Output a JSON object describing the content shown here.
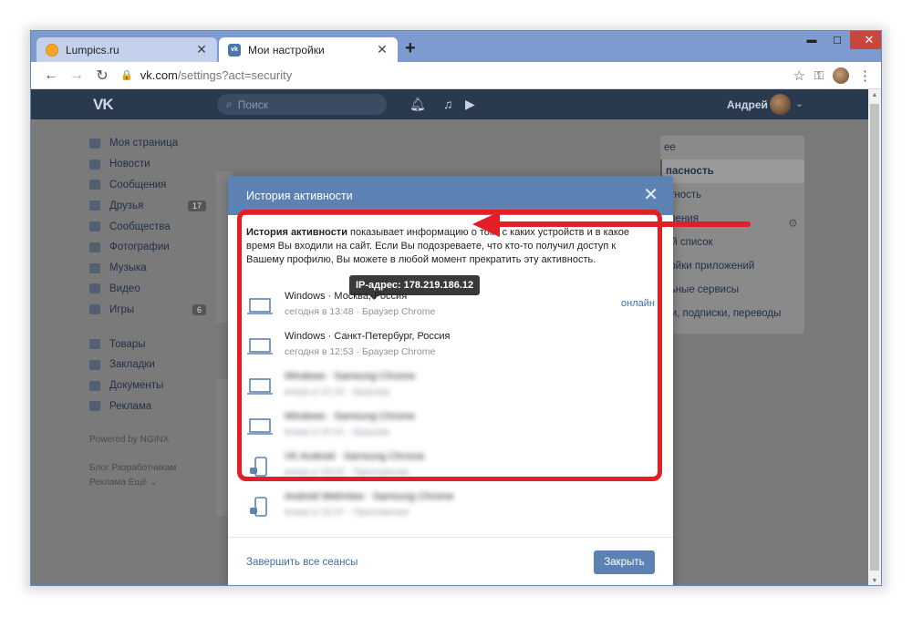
{
  "browser": {
    "tabs": [
      {
        "title": "Lumpics.ru",
        "active": false
      },
      {
        "title": "Мои настройки",
        "active": true
      }
    ],
    "new_tab": "+",
    "url_host": "vk.com",
    "url_path": "/settings?act=security",
    "window_controls": {
      "minimize": "▬",
      "maximize": "☐",
      "close": "✕"
    }
  },
  "vk": {
    "logo": "VK",
    "search_placeholder": "Поиск",
    "user_name": "Андрей",
    "left_nav": [
      {
        "label": "Моя страница",
        "count": ""
      },
      {
        "label": "Новости",
        "count": ""
      },
      {
        "label": "Сообщения",
        "count": ""
      },
      {
        "label": "Друзья",
        "count": "17"
      },
      {
        "label": "Сообщества",
        "count": ""
      },
      {
        "label": "Фотографии",
        "count": ""
      },
      {
        "label": "Музыка",
        "count": ""
      },
      {
        "label": "Видео",
        "count": ""
      },
      {
        "label": "Игры",
        "count": "6"
      }
    ],
    "left_nav2": [
      "Товары",
      "Закладки",
      "Документы",
      "Реклама"
    ],
    "powered": "Powered by NGINX",
    "footer_links_1": "Блог   Разработчикам",
    "footer_links_2": "Реклама   Ещё ⌄",
    "settings_menu": [
      "ее",
      "пасность",
      "атность",
      "вления",
      "ый список",
      "ройки приложений",
      "льные сервисы",
      "жи, подписки, переводы"
    ]
  },
  "modal": {
    "title": "История активности",
    "close": "✕",
    "desc_bold": "История активности",
    "desc_rest": " показывает информацию о том, с каких устройств и в какое время Вы входили на сайт. Если Вы подозреваете, что кто-то получил доступ к Вашему профилю, Вы можете в любой момент прекратить эту активность.",
    "tooltip": "IP-адрес: 178.219.186.12",
    "sessions": [
      {
        "device": "Windows",
        "location": "Москва, Россия",
        "time": "сегодня в 13:48",
        "browser": "Браузер Chrome",
        "status": "онлайн",
        "type": "laptop"
      },
      {
        "device": "Windows",
        "location": "Санкт-Петербург, Россия",
        "time": "сегодня в 12:53",
        "browser": "Браузер Chrome",
        "status": "",
        "type": "laptop"
      },
      {
        "device": "Windows",
        "location": "Samsung Chrome",
        "time": "вчера в 22:10",
        "browser": "Браузер",
        "status": "",
        "type": "laptop"
      },
      {
        "device": "Windows",
        "location": "Samsung Chrome",
        "time": "вчера в 20:41",
        "browser": "Браузер",
        "status": "",
        "type": "laptop"
      },
      {
        "device": "VK Android",
        "location": "Samsung Chrome",
        "time": "вчера в 18:02",
        "browser": "Приложение",
        "status": "",
        "type": "phone"
      },
      {
        "device": "Android WebView",
        "location": "Samsung Chrome",
        "time": "вчера в 16:37",
        "browser": "Приложение",
        "status": "",
        "type": "phone"
      }
    ],
    "end_all": "Завершить все сеансы",
    "close_button": "Закрыть"
  },
  "colors": {
    "annotation_red": "#e31e24",
    "vk_blue": "#5b82b3",
    "link_blue": "#3f6fa5"
  }
}
